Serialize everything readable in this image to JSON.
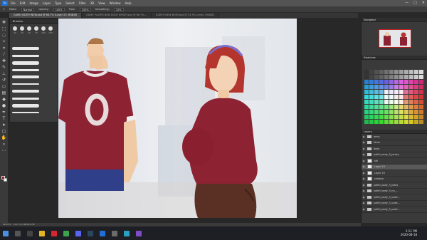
{
  "menubar": {
    "items": [
      "File",
      "Edit",
      "Image",
      "Layer",
      "Type",
      "Select",
      "Filter",
      "3D",
      "View",
      "Window",
      "Help"
    ],
    "window_controls": [
      "—",
      "□",
      "✕"
    ]
  },
  "options_bar": {
    "tool": "Mode:",
    "mode": "Normal",
    "opacity_label": "Opacity:",
    "opacity": "100%",
    "flow_label": "Flow:",
    "flow": "100%",
    "smoothing_label": "Smoothing:",
    "smoothing": "10%"
  },
  "tabs": [
    {
      "label": "GAME JUDITH NEW.psd @ 66.7% (Layer 23, RGB/8)",
      "active": true
    },
    {
      "label": "GAME PLAYER NEW BODY JERSEY.psd @ 66.7%...",
      "active": false
    },
    {
      "label": "JUDITH NEW BODY.psd @ 33.3% (arms, RGB/8)",
      "active": false
    }
  ],
  "brush_panel": {
    "title": "Brushes",
    "sizes": [
      "30",
      "25",
      "40",
      "75",
      "100",
      "125"
    ],
    "rows": [
      "",
      "",
      "",
      "",
      "",
      "",
      "",
      "",
      "",
      ""
    ]
  },
  "right_panel": {
    "navigator_title": "Navigator",
    "swatches_title": "Swatches",
    "layers_title": "Layers",
    "layers": [
      {
        "name": "arms",
        "type": "folder"
      },
      {
        "name": "faces",
        "type": "folder"
      },
      {
        "name": "body",
        "type": "folder"
      },
      {
        "name": "judith_body_3_jersey",
        "type": "folder"
      },
      {
        "name": "tail",
        "type": "layer"
      },
      {
        "name": "Layer 23",
        "type": "layer",
        "selected": true
      },
      {
        "name": "Layer 20",
        "type": "layer"
      },
      {
        "name": "shadow",
        "type": "layer"
      },
      {
        "name": "judith_body_3_jeans",
        "type": "folder"
      },
      {
        "name": "judith_body_3_no_...",
        "type": "folder"
      },
      {
        "name": "judith_body_3_used...",
        "type": "folder"
      },
      {
        "name": "judith_body_3_used...",
        "type": "folder"
      },
      {
        "name": "judith_body_3_used...",
        "type": "folder"
      }
    ]
  },
  "status": {
    "zoom": "66.67%",
    "doc": "Doc: 12.1M/234.7M"
  },
  "taskbar": {
    "time": "2:11 PM",
    "date": "2020-08-18"
  },
  "colors": {
    "jersey": "#8d2233",
    "hair": "#b3352d",
    "skin": "#f3d2b6",
    "jeans": "#2f3f8a",
    "pants": "#5a2f24",
    "headband": "#7a6fd0",
    "fg_swatch": "#8b1a2b"
  }
}
